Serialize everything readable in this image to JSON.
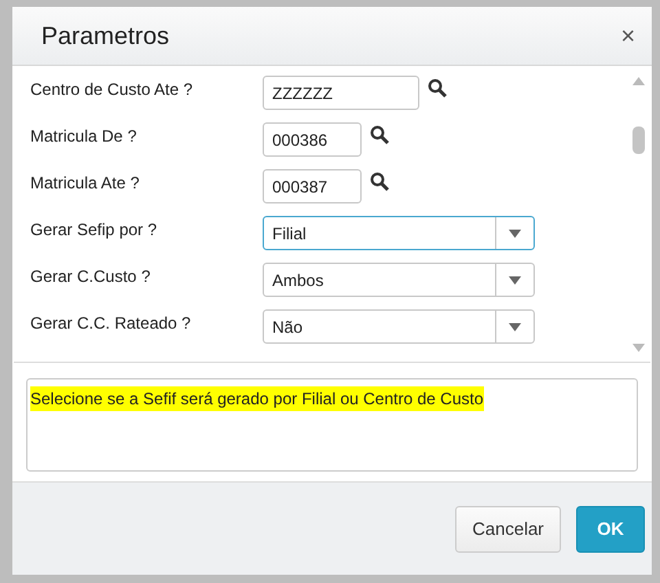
{
  "dialog": {
    "title": "Parametros",
    "close": "×"
  },
  "fields": [
    {
      "kind": "lookup",
      "label": "Centro de Custo Ate ?",
      "value": "ZZZZZZ",
      "wide": true,
      "focused": false
    },
    {
      "kind": "lookup",
      "label": "Matricula De ?",
      "value": "000386",
      "wide": false,
      "focused": false
    },
    {
      "kind": "lookup",
      "label": "Matricula Ate ?",
      "value": "000387",
      "wide": false,
      "focused": false
    },
    {
      "kind": "select",
      "label": "Gerar Sefip por ?",
      "value": "Filial",
      "focused": true
    },
    {
      "kind": "select",
      "label": "Gerar C.Custo ?",
      "value": "Ambos",
      "focused": false
    },
    {
      "kind": "select",
      "label": "Gerar C.C. Rateado ?",
      "value": "Não",
      "focused": false
    }
  ],
  "help": {
    "text": "Selecione se a Sefif será gerado por Filial ou Centro de Custo",
    "highlighted": true
  },
  "buttons": [
    {
      "label": "Cancelar",
      "kind": "secondary"
    },
    {
      "label": "OK",
      "kind": "primary"
    }
  ]
}
